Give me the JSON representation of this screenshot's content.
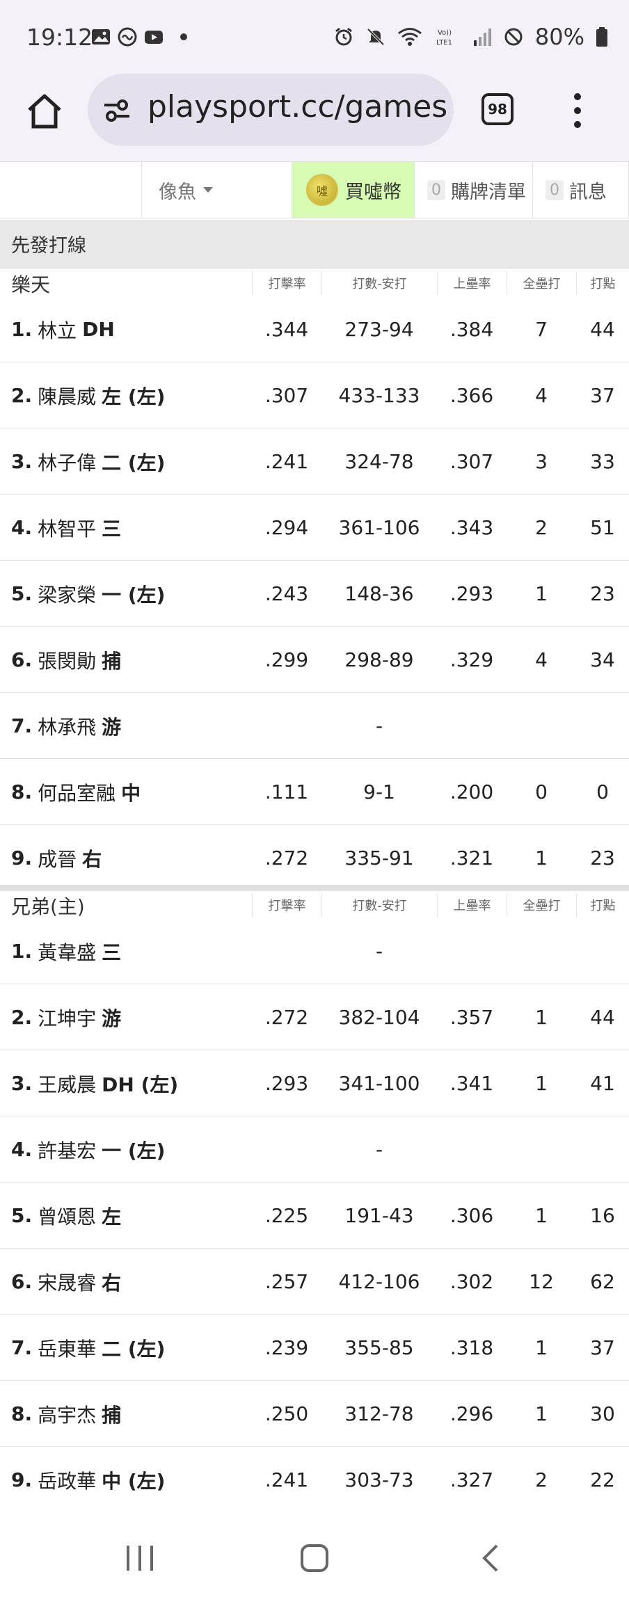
{
  "status": {
    "time": "19:12",
    "battery": "80%"
  },
  "browser": {
    "url": "playsport.cc/games",
    "tab_count": "98"
  },
  "nav": {
    "user": "像魚",
    "buy": "買噓幣",
    "cart_count": "0",
    "cart": "購牌清單",
    "msg_count": "0",
    "msg": "訊息"
  },
  "section_title": "先發打線",
  "columns": [
    "打擊率",
    "打數-安打",
    "上壘率",
    "全壘打",
    "打點"
  ],
  "teams": [
    {
      "name": "樂天",
      "players": [
        {
          "num": "1.",
          "name": "林立",
          "pos": "DH",
          "avg": ".344",
          "ab_h": "273-94",
          "obp": ".384",
          "hr": "7",
          "rbi": "44"
        },
        {
          "num": "2.",
          "name": "陳晨威",
          "pos": "左 (左)",
          "avg": ".307",
          "ab_h": "433-133",
          "obp": ".366",
          "hr": "4",
          "rbi": "37"
        },
        {
          "num": "3.",
          "name": "林子偉",
          "pos": "二 (左)",
          "avg": ".241",
          "ab_h": "324-78",
          "obp": ".307",
          "hr": "3",
          "rbi": "33"
        },
        {
          "num": "4.",
          "name": "林智平",
          "pos": "三",
          "avg": ".294",
          "ab_h": "361-106",
          "obp": ".343",
          "hr": "2",
          "rbi": "51"
        },
        {
          "num": "5.",
          "name": "梁家榮",
          "pos": "一 (左)",
          "avg": ".243",
          "ab_h": "148-36",
          "obp": ".293",
          "hr": "1",
          "rbi": "23"
        },
        {
          "num": "6.",
          "name": "張閔勛",
          "pos": "捕",
          "avg": ".299",
          "ab_h": "298-89",
          "obp": ".329",
          "hr": "4",
          "rbi": "34"
        },
        {
          "num": "7.",
          "name": "林承飛",
          "pos": "游",
          "avg": "",
          "ab_h": "-",
          "obp": "",
          "hr": "",
          "rbi": ""
        },
        {
          "num": "8.",
          "name": "何品室融",
          "pos": "中",
          "avg": ".111",
          "ab_h": "9-1",
          "obp": ".200",
          "hr": "0",
          "rbi": "0"
        },
        {
          "num": "9.",
          "name": "成晉",
          "pos": "右",
          "avg": ".272",
          "ab_h": "335-91",
          "obp": ".321",
          "hr": "1",
          "rbi": "23"
        }
      ]
    },
    {
      "name": "兄弟(主)",
      "players": [
        {
          "num": "1.",
          "name": "黃韋盛",
          "pos": "三",
          "avg": "",
          "ab_h": "-",
          "obp": "",
          "hr": "",
          "rbi": ""
        },
        {
          "num": "2.",
          "name": "江坤宇",
          "pos": "游",
          "avg": ".272",
          "ab_h": "382-104",
          "obp": ".357",
          "hr": "1",
          "rbi": "44"
        },
        {
          "num": "3.",
          "name": "王威晨",
          "pos": "DH (左)",
          "avg": ".293",
          "ab_h": "341-100",
          "obp": ".341",
          "hr": "1",
          "rbi": "41"
        },
        {
          "num": "4.",
          "name": "許基宏",
          "pos": "一 (左)",
          "avg": "",
          "ab_h": "-",
          "obp": "",
          "hr": "",
          "rbi": ""
        },
        {
          "num": "5.",
          "name": "曾頌恩",
          "pos": "左",
          "avg": ".225",
          "ab_h": "191-43",
          "obp": ".306",
          "hr": "1",
          "rbi": "16"
        },
        {
          "num": "6.",
          "name": "宋晟睿",
          "pos": "右",
          "avg": ".257",
          "ab_h": "412-106",
          "obp": ".302",
          "hr": "12",
          "rbi": "62"
        },
        {
          "num": "7.",
          "name": "岳東華",
          "pos": "二 (左)",
          "avg": ".239",
          "ab_h": "355-85",
          "obp": ".318",
          "hr": "1",
          "rbi": "37"
        },
        {
          "num": "8.",
          "name": "高宇杰",
          "pos": "捕",
          "avg": ".250",
          "ab_h": "312-78",
          "obp": ".296",
          "hr": "1",
          "rbi": "30"
        },
        {
          "num": "9.",
          "name": "岳政華",
          "pos": "中 (左)",
          "avg": ".241",
          "ab_h": "303-73",
          "obp": ".327",
          "hr": "2",
          "rbi": "22"
        }
      ]
    }
  ]
}
